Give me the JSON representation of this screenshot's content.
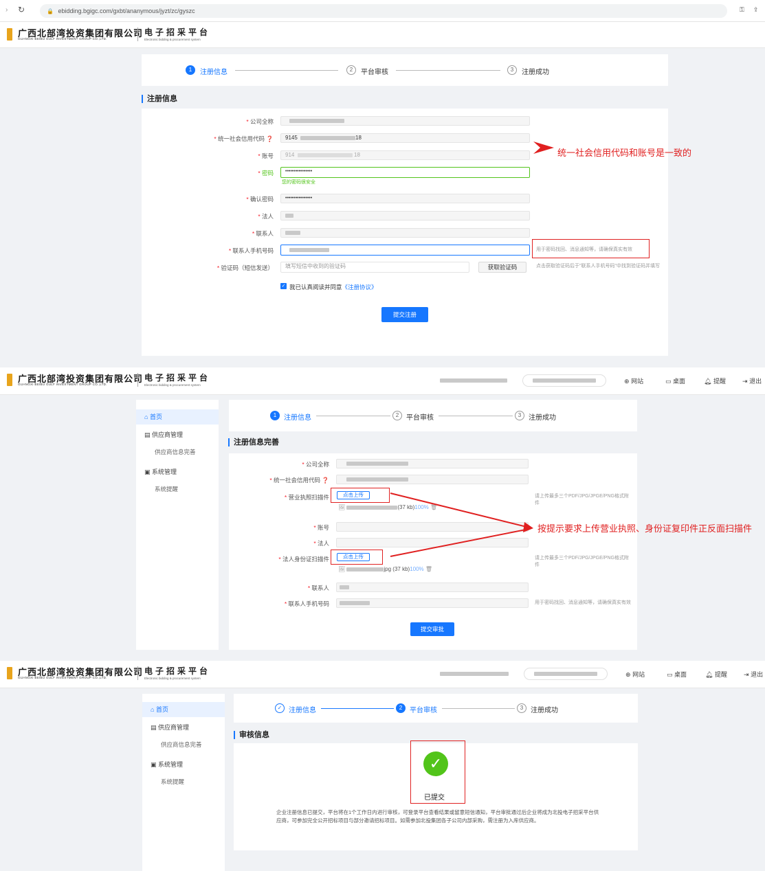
{
  "browser": {
    "url": "ebidding.bgigc.com/gxbt/ananymous/jyzt/zc/gyszc"
  },
  "brand": {
    "cn": "广西北部湾投资集团有限公司",
    "en": "GUANGXI BEIBU GULF INVESTMENT GROUP CO.,LTD.",
    "platform_cn": "电子招采平台",
    "platform_en": "Electronic bidding & procurement system"
  },
  "nav": {
    "site": "网站",
    "desk": "桌面",
    "remind": "提醒",
    "logout": "退出"
  },
  "steps": [
    "注册信息",
    "平台审核",
    "注册成功"
  ],
  "panel1": {
    "section_title": "注册信息",
    "fields": {
      "company": "公司全称",
      "credit_code": "统一社会信用代码",
      "credit_code_value": "9145",
      "credit_code_tail": "18",
      "account": "账号",
      "account_value": "914",
      "account_tail": "18",
      "password": "密码",
      "password_value": "••••••••••••••••",
      "password_hint": "您的密码很安全",
      "confirm_password": "确认密码",
      "confirm_value": "••••••••••••••••",
      "legal_person": "法人",
      "contact": "联系人",
      "contact_phone": "联系人手机号码",
      "phone_hint": "用于密码找回、消息通知等，请确保真实有效",
      "verify_code": "验证码（短信发送）",
      "verify_placeholder": "填写短信中收到的验证码",
      "get_code": "获取验证码",
      "verify_hint": "点击获取验证码后于\"联系人手机号码\"中找到验证码并填写"
    },
    "agree_text": "我已认真阅读并同意",
    "agree_link": "《注册协议》",
    "submit": "提交注册",
    "annotation": "统一社会信用代码和账号是一致的"
  },
  "sidebar": {
    "home": "首页",
    "supplier_mgmt": "供应商管理",
    "supplier_info": "供应商信息完善",
    "sys_mgmt": "系统管理",
    "sys_remind": "系统提醒"
  },
  "panel2": {
    "section_title": "注册信息完善",
    "fields": {
      "company": "公司全称",
      "credit_code": "统一社会信用代码",
      "license": "营业执照扫描件",
      "upload": "点击上传",
      "license_file_size": "(37 kb)",
      "license_progress": "100%",
      "upload_hint": "请上传最多三个PDF/JPG/JPGE/PNG格式附件",
      "account": "账号",
      "legal_person": "法人",
      "id_scan": "法人身份证扫描件",
      "id_file": "jpg (37 kb)",
      "id_progress": "100%",
      "contact": "联系人",
      "contact_phone": "联系人手机号码",
      "phone_hint": "用于密码找回、消息通知等，请确保真实有效"
    },
    "submit": "提交审批",
    "annotation": "按提示要求上传营业执照、身份证复印件正反面扫描件"
  },
  "panel3": {
    "section_title": "审核信息",
    "status": "已提交",
    "message": "企业注册信息已提交，平台将在1个工作日内进行审核，可登录平台查看结果或留意短信通知，平台审批通过后企业将成为北投电子招采平台供应商，可参加完全公开招标项目与部分邀请招标项目。如需参加北投集团各子公司内部采购，需注册为入库供应商。"
  },
  "colors": {
    "primary": "#1677ff",
    "annotation": "#e02020",
    "logo": "#e8a41c",
    "success": "#52c41a"
  }
}
